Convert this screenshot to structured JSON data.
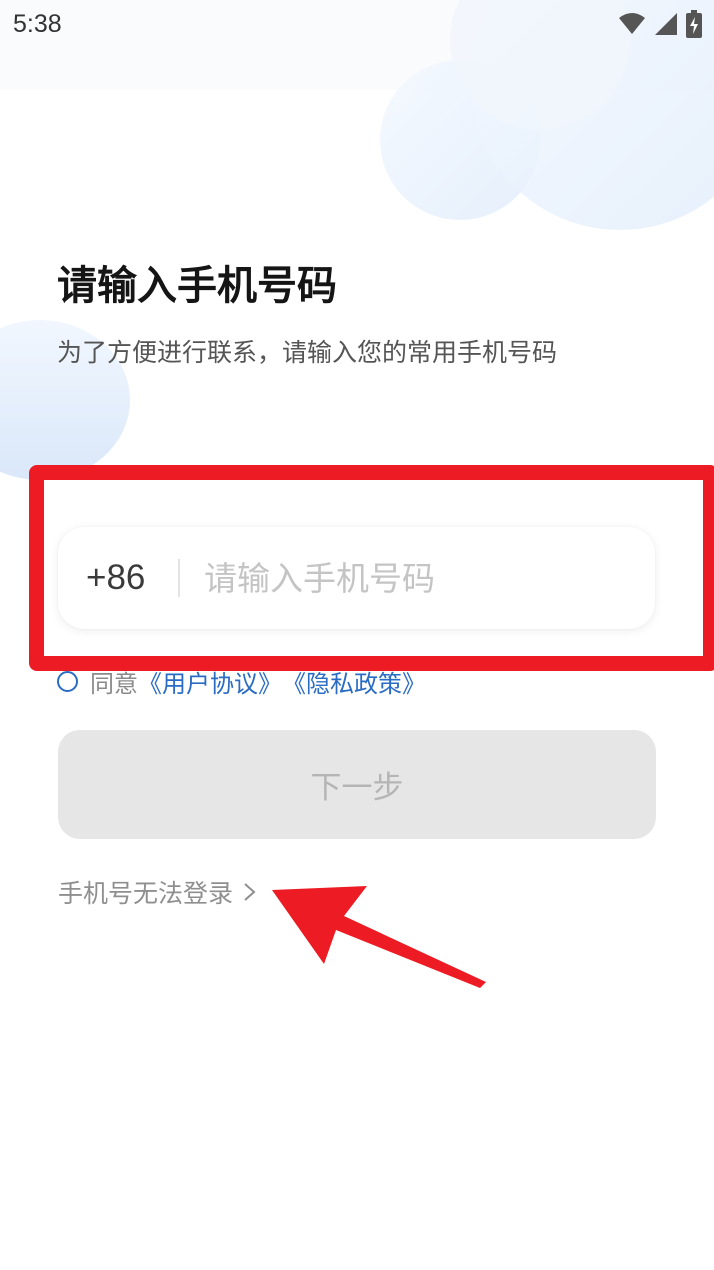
{
  "status_bar": {
    "time": "5:38",
    "icons": [
      "wifi-icon",
      "signal-icon",
      "battery-charging-icon"
    ]
  },
  "page": {
    "title": "请输入手机号码",
    "subtitle": "为了方便进行联系，请输入您的常用手机号码"
  },
  "phone_field": {
    "country_code": "+86",
    "value": "",
    "placeholder": "请输入手机号码"
  },
  "agreement": {
    "checked": false,
    "prefix": "同意",
    "user_agreement_link": "《用户协议》",
    "privacy_policy_link": "《隐私政策》"
  },
  "next_button": {
    "label": "下一步",
    "enabled": false
  },
  "cannot_login_link": {
    "label": "手机号无法登录"
  },
  "colors": {
    "accent_blue": "#2a6cc4",
    "annotation_red": "#ed1c24",
    "button_disabled_bg": "#e6e6e6",
    "button_disabled_text": "#b5b5b5"
  }
}
